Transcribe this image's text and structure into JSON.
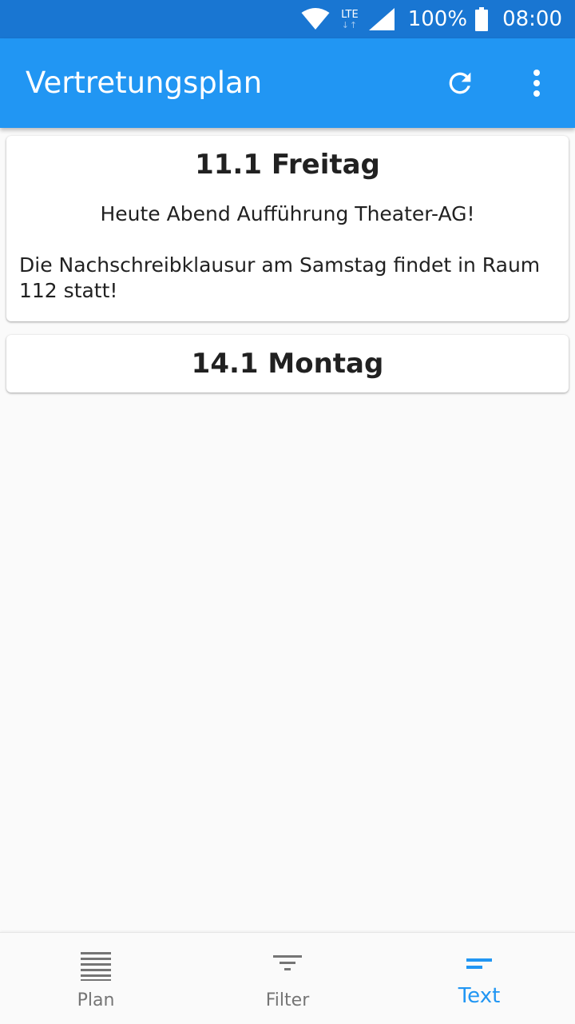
{
  "status_bar": {
    "network": "LTE",
    "battery": "100%",
    "time": "08:00"
  },
  "app_bar": {
    "title": "Vertretungsplan",
    "icons": [
      "refresh-icon",
      "more-vert-icon"
    ],
    "color": "#2196f3"
  },
  "cards": [
    {
      "title": "11.1 Freitag",
      "center_text": "Heute Abend Aufführung Theater-AG!",
      "text": "Die Nachschreibklausur am Samstag findet in Raum 112 statt!"
    },
    {
      "title": "14.1 Montag"
    }
  ],
  "bottom_nav": {
    "items": [
      {
        "label": "Plan",
        "icon": "plan-list-icon",
        "active": false
      },
      {
        "label": "Filter",
        "icon": "filter-icon",
        "active": false
      },
      {
        "label": "Text",
        "icon": "text-icon",
        "active": true
      }
    ],
    "active_color": "#2196f3",
    "inactive_color": "#757575"
  }
}
